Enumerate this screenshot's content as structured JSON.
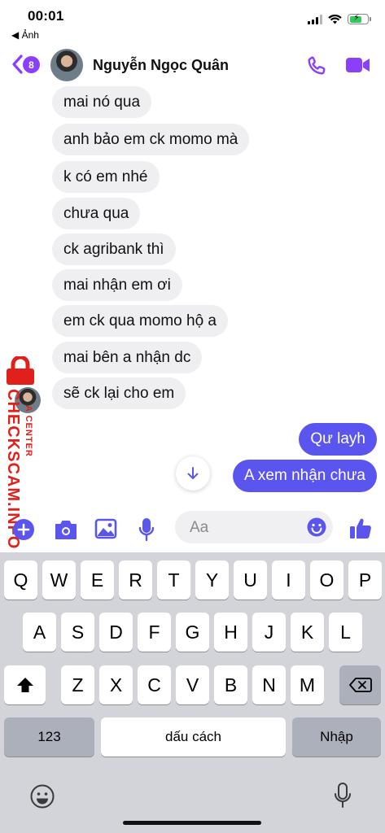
{
  "status_bar": {
    "time": "00:01",
    "back_label": "◀ Ảnh"
  },
  "header": {
    "unread_count": "8",
    "contact_name": "Nguyễn Ngọc Quân",
    "accent_color": "#8a3ffc"
  },
  "messages": {
    "incoming": [
      "mai nó qua",
      "anh bảo em ck momo mà",
      "k có em nhé",
      "chưa qua",
      "ck agribank thì",
      "mai nhận em ơi",
      "em ck qua momo hộ a",
      "mai bên a nhận dc",
      "sẽ ck lại cho em"
    ],
    "outgoing": [
      "Qư layh",
      "A xem nhận chưa"
    ],
    "outgoing_color": "#5b55f0"
  },
  "watermark": {
    "main": "CHECKSCAM.INFO",
    "sub": "A CENTER",
    "color": "#e0201b"
  },
  "composer": {
    "placeholder": "Aa"
  },
  "keyboard": {
    "row1": [
      "Q",
      "W",
      "E",
      "R",
      "T",
      "Y",
      "U",
      "I",
      "O",
      "P"
    ],
    "row2": [
      "A",
      "S",
      "D",
      "F",
      "G",
      "H",
      "J",
      "K",
      "L"
    ],
    "row3": [
      "Z",
      "X",
      "C",
      "V",
      "B",
      "N",
      "M"
    ],
    "numbers_label": "123",
    "space_label": "dấu cách",
    "return_label": "Nhập"
  }
}
